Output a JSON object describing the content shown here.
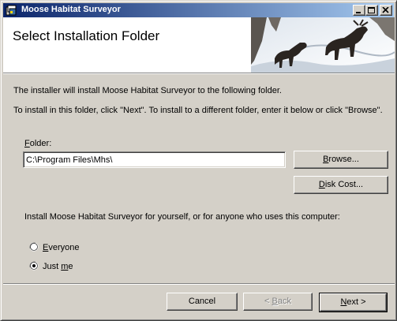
{
  "window": {
    "title": "Moose Habitat Surveyor",
    "controls": {
      "minimize": "minimize",
      "maximize": "maximize",
      "close": "close"
    }
  },
  "header": {
    "title": "Select Installation Folder",
    "banner_image": "moose-in-snow"
  },
  "body": {
    "intro": "The installer will install Moose Habitat Surveyor to the following folder.",
    "instruction": "To install in this folder, click \"Next\". To install to a different folder, enter it below or click \"Browse\".",
    "folder_label": "Folder:",
    "folder_value": "C:\\Program Files\\Mhs\\",
    "browse_label": "Browse...",
    "disk_cost_label": "Disk Cost...",
    "scope_question": "Install Moose Habitat Surveyor for yourself, or for anyone who uses this computer:",
    "options": [
      {
        "label": "Everyone",
        "selected": false
      },
      {
        "label": "Just me",
        "selected": true
      }
    ]
  },
  "footer": {
    "cancel_label": "Cancel",
    "back_label": "< Back",
    "next_label": "Next >"
  },
  "colors": {
    "face": "#d4d0c8",
    "title_start": "#0a246a",
    "title_end": "#a6caf0"
  }
}
